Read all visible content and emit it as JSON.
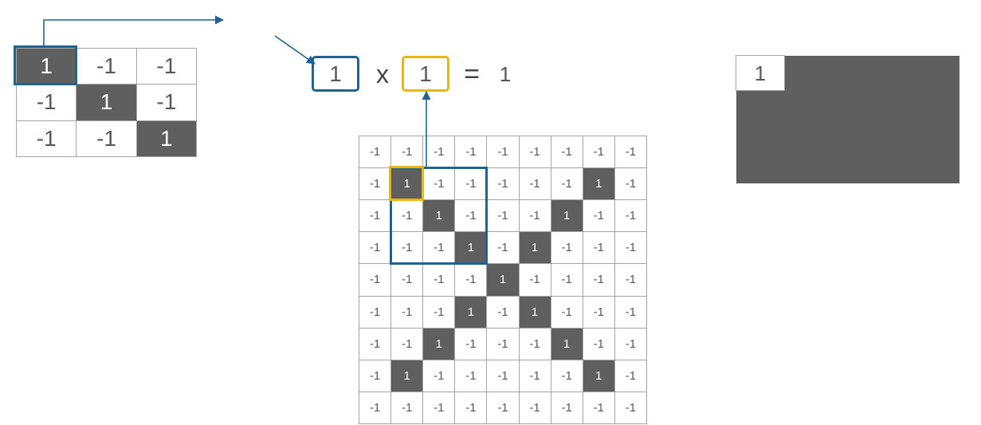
{
  "filter": {
    "size": 3,
    "cells": [
      {
        "v": 1,
        "dark": true
      },
      {
        "v": -1,
        "dark": false
      },
      {
        "v": -1,
        "dark": false
      },
      {
        "v": -1,
        "dark": false
      },
      {
        "v": 1,
        "dark": true
      },
      {
        "v": -1,
        "dark": false
      },
      {
        "v": -1,
        "dark": false
      },
      {
        "v": -1,
        "dark": false
      },
      {
        "v": 1,
        "dark": true
      }
    ],
    "highlight": {
      "row": 0,
      "col": 0
    }
  },
  "image": {
    "size": 9,
    "cells": [
      {
        "v": -1,
        "dark": false
      },
      {
        "v": -1,
        "dark": false
      },
      {
        "v": -1,
        "dark": false
      },
      {
        "v": -1,
        "dark": false
      },
      {
        "v": -1,
        "dark": false
      },
      {
        "v": -1,
        "dark": false
      },
      {
        "v": -1,
        "dark": false
      },
      {
        "v": -1,
        "dark": false
      },
      {
        "v": -1,
        "dark": false
      },
      {
        "v": -1,
        "dark": false
      },
      {
        "v": 1,
        "dark": true
      },
      {
        "v": -1,
        "dark": false
      },
      {
        "v": -1,
        "dark": false
      },
      {
        "v": -1,
        "dark": false
      },
      {
        "v": -1,
        "dark": false
      },
      {
        "v": -1,
        "dark": false
      },
      {
        "v": 1,
        "dark": true
      },
      {
        "v": -1,
        "dark": false
      },
      {
        "v": -1,
        "dark": false
      },
      {
        "v": -1,
        "dark": false
      },
      {
        "v": 1,
        "dark": true
      },
      {
        "v": -1,
        "dark": false
      },
      {
        "v": -1,
        "dark": false
      },
      {
        "v": -1,
        "dark": false
      },
      {
        "v": 1,
        "dark": true
      },
      {
        "v": -1,
        "dark": false
      },
      {
        "v": -1,
        "dark": false
      },
      {
        "v": -1,
        "dark": false
      },
      {
        "v": -1,
        "dark": false
      },
      {
        "v": -1,
        "dark": false
      },
      {
        "v": 1,
        "dark": true
      },
      {
        "v": -1,
        "dark": false
      },
      {
        "v": 1,
        "dark": true
      },
      {
        "v": -1,
        "dark": false
      },
      {
        "v": -1,
        "dark": false
      },
      {
        "v": -1,
        "dark": false
      },
      {
        "v": -1,
        "dark": false
      },
      {
        "v": -1,
        "dark": false
      },
      {
        "v": -1,
        "dark": false
      },
      {
        "v": -1,
        "dark": false
      },
      {
        "v": 1,
        "dark": true
      },
      {
        "v": -1,
        "dark": false
      },
      {
        "v": -1,
        "dark": false
      },
      {
        "v": -1,
        "dark": false
      },
      {
        "v": -1,
        "dark": false
      },
      {
        "v": -1,
        "dark": false
      },
      {
        "v": -1,
        "dark": false
      },
      {
        "v": -1,
        "dark": false
      },
      {
        "v": 1,
        "dark": true
      },
      {
        "v": -1,
        "dark": false
      },
      {
        "v": 1,
        "dark": true
      },
      {
        "v": -1,
        "dark": false
      },
      {
        "v": -1,
        "dark": false
      },
      {
        "v": -1,
        "dark": false
      },
      {
        "v": -1,
        "dark": false
      },
      {
        "v": -1,
        "dark": false
      },
      {
        "v": 1,
        "dark": true
      },
      {
        "v": -1,
        "dark": false
      },
      {
        "v": -1,
        "dark": false
      },
      {
        "v": -1,
        "dark": false
      },
      {
        "v": 1,
        "dark": true
      },
      {
        "v": -1,
        "dark": false
      },
      {
        "v": -1,
        "dark": false
      },
      {
        "v": -1,
        "dark": false
      },
      {
        "v": 1,
        "dark": true
      },
      {
        "v": -1,
        "dark": false
      },
      {
        "v": -1,
        "dark": false
      },
      {
        "v": -1,
        "dark": false
      },
      {
        "v": -1,
        "dark": false
      },
      {
        "v": -1,
        "dark": false
      },
      {
        "v": 1,
        "dark": true
      },
      {
        "v": -1,
        "dark": false
      },
      {
        "v": -1,
        "dark": false
      },
      {
        "v": -1,
        "dark": false
      },
      {
        "v": -1,
        "dark": false
      },
      {
        "v": -1,
        "dark": false
      },
      {
        "v": -1,
        "dark": false
      },
      {
        "v": -1,
        "dark": false
      },
      {
        "v": -1,
        "dark": false
      },
      {
        "v": -1,
        "dark": false
      },
      {
        "v": -1,
        "dark": false
      }
    ],
    "highlight_window": {
      "row": 1,
      "col": 1,
      "size": 3
    },
    "highlight_cell": {
      "row": 1,
      "col": 1
    }
  },
  "output": {
    "cell_value": 1
  },
  "equation": {
    "left": 1,
    "multiply_symbol": "x",
    "right": 1,
    "equals_symbol": "=",
    "result": 1
  }
}
